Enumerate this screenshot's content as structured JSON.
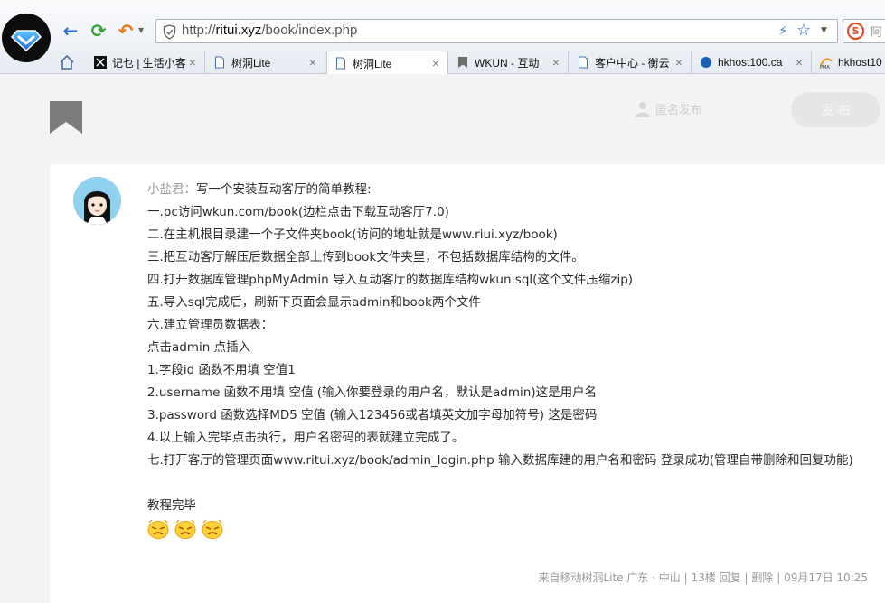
{
  "browser": {
    "address": {
      "scheme": "http://",
      "host": "ritui.xyz",
      "path": "/book/index.php"
    },
    "search_hint": "阿",
    "tabs": [
      {
        "label": "记乜 | 生活小客",
        "icon": "black-square-icon",
        "active": false
      },
      {
        "label": "树洞Lite",
        "icon": "page-icon",
        "active": false
      },
      {
        "label": "树洞Lite",
        "icon": "page-icon",
        "active": true
      },
      {
        "label": "WKUN - 互动",
        "icon": "bookmark-icon",
        "active": false
      },
      {
        "label": "客户中心 - 衡云",
        "icon": "page-icon",
        "active": false
      },
      {
        "label": "hkhost100.ca",
        "icon": "blue-globe-icon",
        "active": false
      },
      {
        "label": "hkhost10",
        "icon": "pma-icon",
        "active": false
      }
    ]
  },
  "page": {
    "anon_label": "匿名发布",
    "publish_label": "发 布"
  },
  "post": {
    "author": "小盐君：",
    "lines": [
      "写一个安装互动客厅的简单教程:",
      "一.pc访问wkun.com/book(边栏点击下载互动客厅7.0)",
      "二.在主机根目录建一个子文件夹book(访问的地址就是www.riui.xyz/book)",
      "三.把互动客厅解压后数据全部上传到book文件夹里，不包括数据库结构的文件。",
      "四.打开数据库管理phpMyAdmin 导入互动客厅的数据库结构wkun.sql(这个文件压缩zip)",
      "五.导入sql完成后，刷新下页面会显示admin和book两个文件",
      "六.建立管理员数据表：",
      "点击admin 点插入",
      "1.字段id 函数不用填 空值1",
      "2.username 函数不用填 空值 (输入你要登录的用户名，默认是admin)这是用户名",
      "3.password 函数选择MD5 空值 (输入123456或者填英文加字母加符号) 这是密码",
      "4.以上输入完毕点击执行，用户名密码的表就建立完成了。",
      "七.打开客厅的管理页面www.ritui.xyz/book/admin_login.php 输入数据库建的用户名和密码 登录成功(管理自带删除和回复功能)",
      "",
      "教程完毕"
    ],
    "emojis": [
      "angry-face-icon",
      "angry-face-icon",
      "angry-face-icon"
    ],
    "meta": {
      "source": "来自移动树洞Lite",
      "location": "广东 · 中山",
      "floor": "13楼",
      "reply": "回复",
      "delete": "删除",
      "datetime": "09月17日 10:25",
      "sep": "|"
    }
  }
}
